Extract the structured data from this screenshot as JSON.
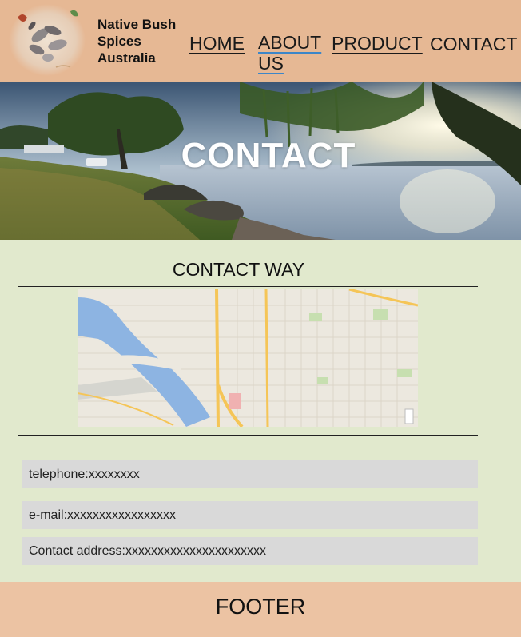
{
  "header": {
    "brand": "Native Bush\nSpices\nAustralia",
    "nav": {
      "home": "HOME",
      "about_line1": "ABOUT",
      "about_line2": "US",
      "product": "PRODUCT",
      "contact": "CONTACT"
    }
  },
  "hero": {
    "title": "CONTACT"
  },
  "main": {
    "section_title": "CONTACT WAY",
    "telephone": "telephone:xxxxxxxx",
    "email": "e-mail:xxxxxxxxxxxxxxxxx",
    "address": "Contact address:xxxxxxxxxxxxxxxxxxxxxx"
  },
  "footer": {
    "text": "FOOTER"
  },
  "colors": {
    "header_bg": "#e6b894",
    "main_bg": "#e1e9cd",
    "info_bg": "#d9d9d9",
    "footer_bg": "#ecc3a3",
    "about_underline": "#3c86c8"
  }
}
